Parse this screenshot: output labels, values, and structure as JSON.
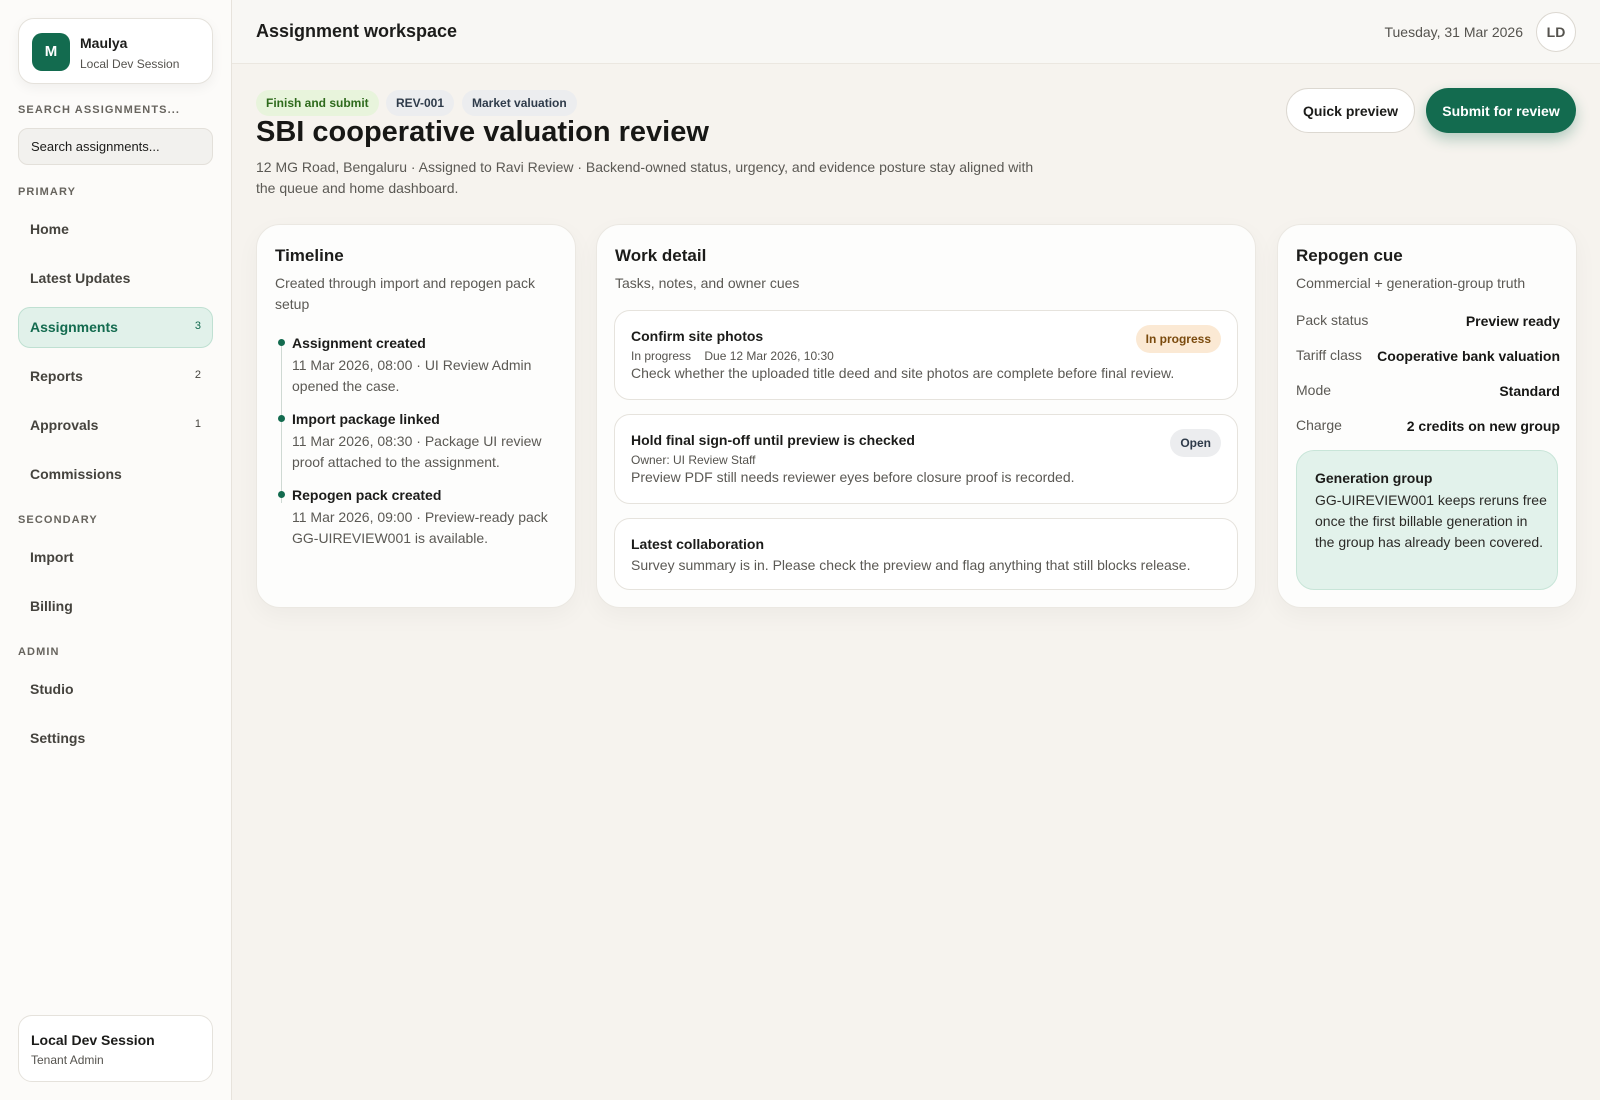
{
  "sidebar": {
    "profile": {
      "initial": "M",
      "name": "Maulya",
      "session": "Local Dev Session"
    },
    "search": {
      "label": "SEARCH ASSIGNMENTS...",
      "placeholder": "Search assignments..."
    },
    "sections": {
      "primary": "PRIMARY",
      "secondary": "SECONDARY",
      "admin": "ADMIN"
    },
    "primary_items": [
      {
        "label": "Home",
        "count": ""
      },
      {
        "label": "Latest Updates",
        "count": ""
      },
      {
        "label": "Assignments",
        "count": "3"
      },
      {
        "label": "Reports",
        "count": "2"
      },
      {
        "label": "Approvals",
        "count": "1"
      },
      {
        "label": "Commissions",
        "count": ""
      }
    ],
    "secondary_items": [
      {
        "label": "Import"
      },
      {
        "label": "Billing"
      }
    ],
    "admin_items": [
      {
        "label": "Studio"
      },
      {
        "label": "Settings"
      }
    ],
    "session_card": {
      "title": "Local Dev Session",
      "role": "Tenant Admin"
    }
  },
  "header": {
    "title": "Assignment workspace",
    "date": "Tuesday, 31 Mar 2026",
    "user_initials": "LD"
  },
  "assignment": {
    "chips": [
      "Finish and submit",
      "REV-001",
      "Market valuation"
    ],
    "title": "SBI cooperative valuation review",
    "subtitle": "12 MG Road, Bengaluru · Assigned to Ravi Review · Backend-owned status, urgency, and evidence posture stay aligned with the queue and home dashboard.",
    "actions": {
      "preview": "Quick preview",
      "submit": "Submit for review"
    }
  },
  "timeline": {
    "title": "Timeline",
    "subtitle": "Created through import and repogen pack setup",
    "events": [
      {
        "title": "Assignment created",
        "body": "11 Mar 2026, 08:00 · UI Review Admin opened the case."
      },
      {
        "title": "Import package linked",
        "body": "11 Mar 2026, 08:30 · Package UI review proof attached to the assignment."
      },
      {
        "title": "Repogen pack created",
        "body": "11 Mar 2026, 09:00 · Preview-ready pack GG-UIREVIEW001 is available."
      }
    ]
  },
  "work_detail": {
    "title": "Work detail",
    "subtitle": "Tasks, notes, and owner cues",
    "tasks": [
      {
        "title": "Confirm site photos",
        "meta_status": "In progress",
        "meta_due": "Due 12 Mar 2026, 10:30",
        "description": "Check whether the uploaded title deed and site photos are complete before final review.",
        "badge": "In progress"
      },
      {
        "title": "Hold final sign-off until preview is checked",
        "meta_owner": "Owner: UI Review Staff",
        "description": "Preview PDF still needs reviewer eyes before closure proof is recorded.",
        "badge": "Open"
      },
      {
        "title": "Latest collaboration",
        "description": "Survey summary is in. Please check the preview and flag anything that still blocks release."
      }
    ]
  },
  "repogen": {
    "title": "Repogen cue",
    "subtitle": "Commercial + generation-group truth",
    "rows": [
      {
        "key": "Pack status",
        "value": "Preview ready"
      },
      {
        "key": "Tariff class",
        "value": "Cooperative bank valuation"
      },
      {
        "key": "Mode",
        "value": "Standard"
      },
      {
        "key": "Charge",
        "value": "2 credits on new group"
      }
    ],
    "generation_group": {
      "title": "Generation group",
      "body": "GG-UIREVIEW001 keeps reruns free once the first billable generation in the group has already been covered."
    }
  },
  "colors": {
    "brand": "#136b4f",
    "active_nav_bg": "#e1f1ea",
    "in_progress_badge": "#fbe9d4",
    "finish_chip": "#e8f4dc"
  }
}
